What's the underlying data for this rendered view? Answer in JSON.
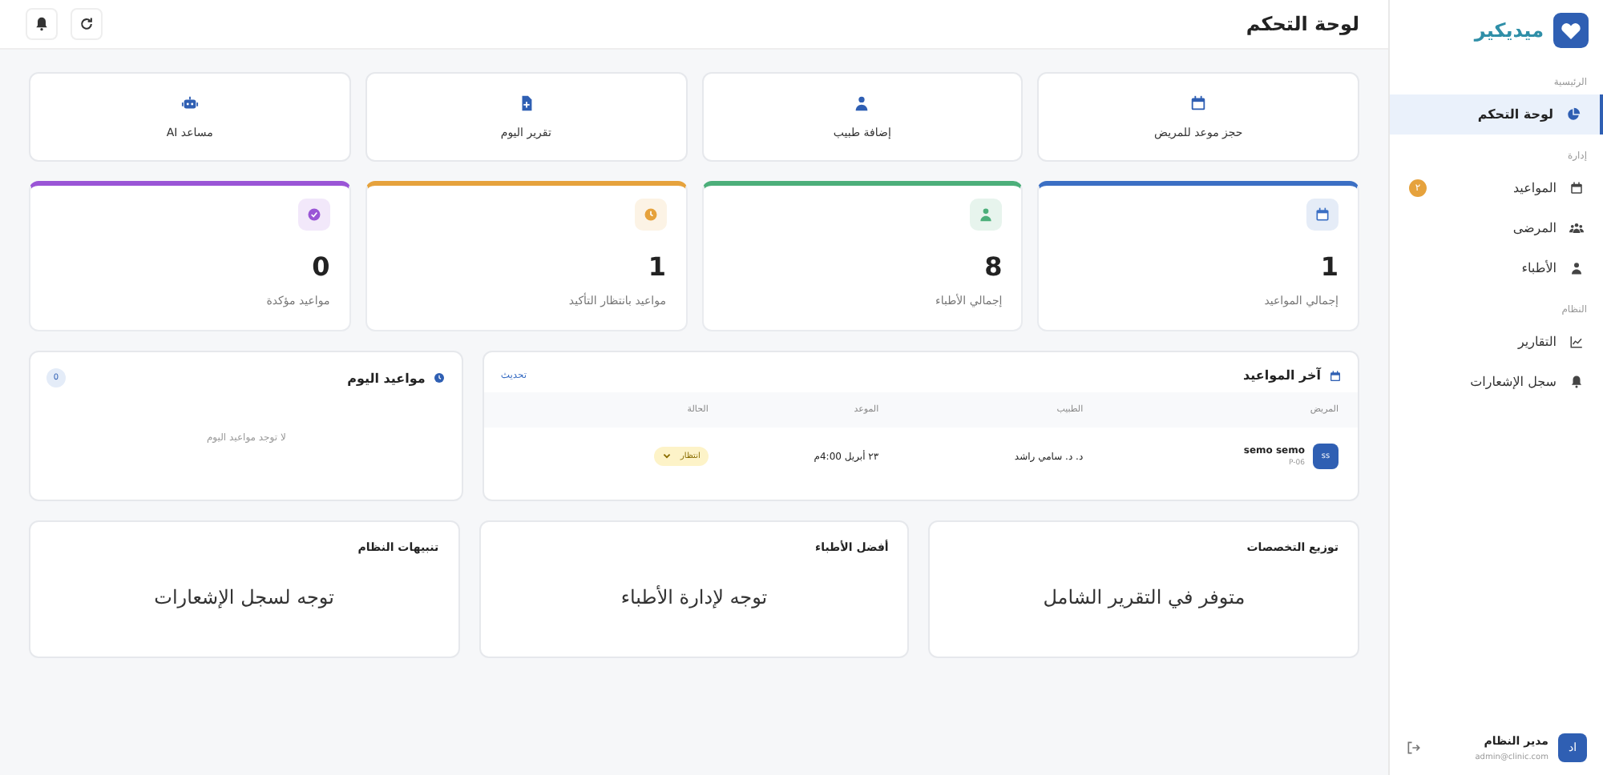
{
  "brand": {
    "name": "ميديكير"
  },
  "sidebar": {
    "sections": [
      {
        "title": "الرئيسية",
        "items": [
          {
            "label": "لوحة التحكم",
            "selected": true
          }
        ]
      },
      {
        "title": "إدارة",
        "items": [
          {
            "label": "المواعيد",
            "selected": false,
            "badge": "٢"
          },
          {
            "label": "المرضى",
            "selected": false
          },
          {
            "label": "الأطباء",
            "selected": false
          }
        ]
      },
      {
        "title": "النظام",
        "items": [
          {
            "label": "التقارير",
            "selected": false
          },
          {
            "label": "سجل الإشعارات",
            "selected": false
          }
        ]
      }
    ]
  },
  "user": {
    "avatar": "اد",
    "name": "مدير النظام",
    "email": "admin@clinic.com"
  },
  "header": {
    "title": "لوحة التحكم"
  },
  "quick_actions": [
    {
      "label": "حجز موعد للمريض"
    },
    {
      "label": "إضافة طبيب"
    },
    {
      "label": "تقرير اليوم"
    },
    {
      "label": "مساعد AI"
    }
  ],
  "stats": [
    {
      "value": "1",
      "label": "إجمالي المواعيد",
      "color": "#3b6fc4"
    },
    {
      "value": "8",
      "label": "إجمالي الأطباء",
      "color": "#4caf7a"
    },
    {
      "value": "1",
      "label": "مواعيد بانتظار التأكيد",
      "color": "#e6a23c"
    },
    {
      "value": "0",
      "label": "مواعيد مؤكدة",
      "color": "#9a55d6"
    }
  ],
  "latest": {
    "title": "آخر المواعيد",
    "refresh": "تحديث",
    "columns": [
      "المريض",
      "الطبيب",
      "الموعد",
      "الحالة"
    ],
    "rows": [
      {
        "avatar": "ss",
        "patient": "semo semo",
        "patient_id": "P-06",
        "doctor": "د. د. سامي راشد",
        "time": "٢٣ أبريل 4:00م",
        "status": "انتظار"
      }
    ]
  },
  "today": {
    "title": "مواعيد اليوم",
    "count": "0",
    "empty": "لا توجد مواعيد اليوم"
  },
  "panels": [
    {
      "title": "توزيع التخصصات",
      "text": "متوفر في التقرير الشامل"
    },
    {
      "title": "أفضل الأطباء",
      "text": "توجه لإدارة الأطباء"
    },
    {
      "title": "تنبيهات النظام",
      "text": "توجه لسجل الإشعارات"
    }
  ]
}
